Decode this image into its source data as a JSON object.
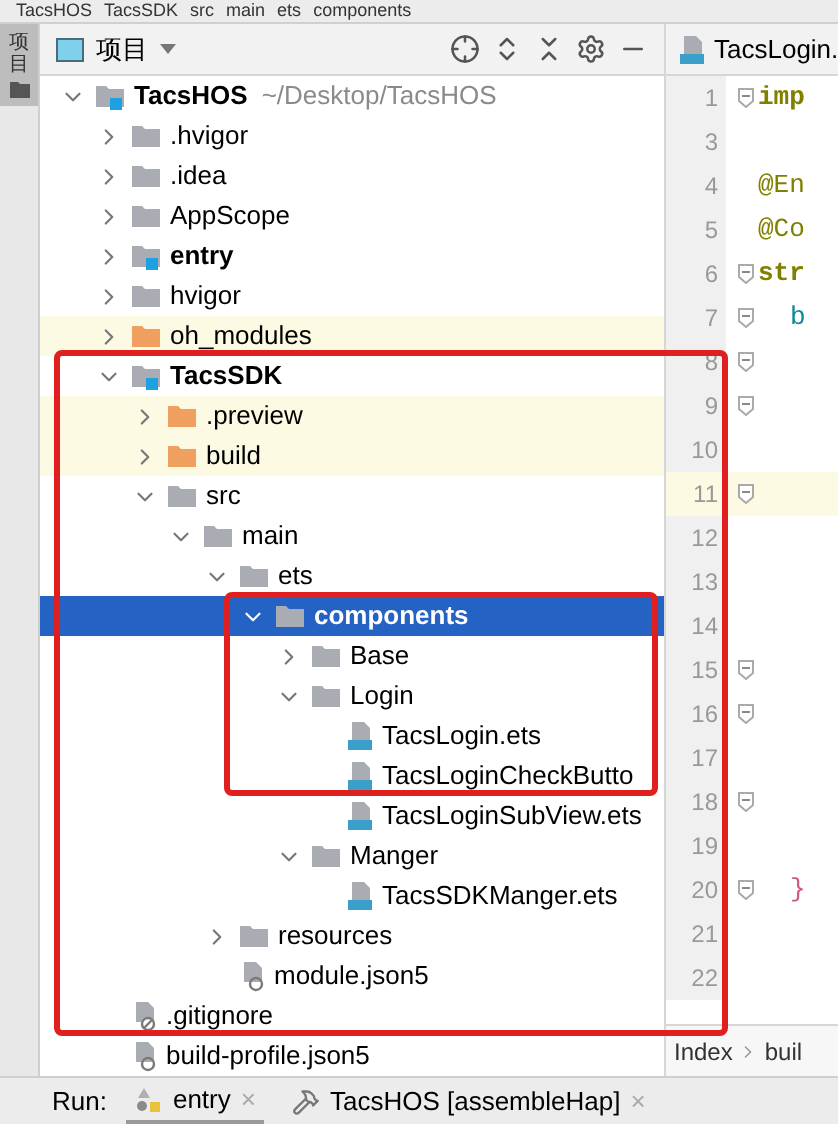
{
  "breadcrumbs": [
    "TacsHOS",
    "TacsSDK",
    "src",
    "main",
    "ets",
    "components"
  ],
  "side_tab": {
    "label": "项目",
    "selected": true
  },
  "project_panel": {
    "title": "项目"
  },
  "tree": [
    {
      "label": "TacsHOS",
      "kind": "module",
      "path": "~/Desktop/TacsHOS",
      "expanded": true,
      "selected": false,
      "children": [
        {
          "label": ".hvigor",
          "kind": "folder",
          "expanded": false,
          "selected": false
        },
        {
          "label": ".idea",
          "kind": "folder",
          "expanded": false,
          "selected": false
        },
        {
          "label": "AppScope",
          "kind": "folder",
          "expanded": false,
          "selected": false
        },
        {
          "label": "entry",
          "kind": "module",
          "expanded": false,
          "selected": false
        },
        {
          "label": "hvigor",
          "kind": "folder",
          "expanded": false,
          "selected": false
        },
        {
          "label": "oh_modules",
          "kind": "excluded",
          "expanded": false,
          "selected": false
        },
        {
          "label": "TacsSDK",
          "kind": "module",
          "expanded": true,
          "selected": false,
          "children": [
            {
              "label": ".preview",
              "kind": "excluded",
              "expanded": false,
              "selected": false
            },
            {
              "label": "build",
              "kind": "excluded",
              "expanded": false,
              "selected": false
            },
            {
              "label": "src",
              "kind": "folder",
              "expanded": true,
              "selected": false,
              "children": [
                {
                  "label": "main",
                  "kind": "folder",
                  "expanded": true,
                  "selected": false,
                  "children": [
                    {
                      "label": "ets",
                      "kind": "folder",
                      "expanded": true,
                      "selected": false,
                      "children": [
                        {
                          "label": "components",
                          "kind": "folder",
                          "expanded": true,
                          "selected": true,
                          "children": [
                            {
                              "label": "Base",
                              "kind": "folder",
                              "expanded": false,
                              "selected": false
                            },
                            {
                              "label": "Login",
                              "kind": "folder",
                              "expanded": true,
                              "selected": false,
                              "children": [
                                {
                                  "label": "TacsLogin.ets",
                                  "kind": "ets",
                                  "selected": false
                                },
                                {
                                  "label": "TacsLoginCheckButto",
                                  "kind": "ets",
                                  "selected": false
                                },
                                {
                                  "label": "TacsLoginSubView.ets",
                                  "kind": "ets",
                                  "selected": false
                                }
                              ]
                            },
                            {
                              "label": "Manger",
                              "kind": "folder",
                              "expanded": true,
                              "selected": false,
                              "children": [
                                {
                                  "label": "TacsSDKManger.ets",
                                  "kind": "ets",
                                  "selected": false
                                }
                              ]
                            }
                          ]
                        }
                      ]
                    },
                    {
                      "label": "resources",
                      "kind": "folder",
                      "expanded": false,
                      "selected": false
                    },
                    {
                      "label": "module.json5",
                      "kind": "json",
                      "selected": false
                    }
                  ]
                }
              ]
            }
          ]
        },
        {
          "label": ".gitignore",
          "kind": "ignore",
          "selected": false
        },
        {
          "label": "build-profile.json5",
          "kind": "json",
          "selected": false
        }
      ]
    }
  ],
  "editor": {
    "tab": "TacsLogin.",
    "lines": [
      {
        "number": "1",
        "code": "imp",
        "kind": "keyword",
        "fold": true,
        "current": false
      },
      {
        "number": "3",
        "fold": false,
        "current": false
      },
      {
        "number": "4",
        "code": "@En",
        "kind": "annotation",
        "fold": false,
        "current": false
      },
      {
        "number": "5",
        "code": "@Co",
        "kind": "annotation",
        "fold": false,
        "current": false
      },
      {
        "number": "6",
        "code": "str",
        "kind": "keyword",
        "fold": true,
        "current": false
      },
      {
        "number": "7",
        "code": "b",
        "kind": "identifier",
        "fold": true,
        "current": false
      },
      {
        "number": "8",
        "fold": true,
        "current": false
      },
      {
        "number": "9",
        "fold": true,
        "current": false
      },
      {
        "number": "10",
        "fold": false,
        "current": false
      },
      {
        "number": "11",
        "fold": true,
        "current": true
      },
      {
        "number": "12",
        "fold": false,
        "current": false
      },
      {
        "number": "13",
        "fold": false,
        "current": false
      },
      {
        "number": "14",
        "fold": false,
        "current": false
      },
      {
        "number": "15",
        "fold": true,
        "current": false
      },
      {
        "number": "16",
        "fold": true,
        "current": false
      },
      {
        "number": "17",
        "fold": false,
        "current": false
      },
      {
        "number": "18",
        "fold": true,
        "current": false
      },
      {
        "number": "19",
        "fold": false,
        "current": false
      },
      {
        "number": "20",
        "code": "}",
        "kind": "brace",
        "fold": true,
        "current": false
      },
      {
        "number": "21",
        "fold": false,
        "current": false
      },
      {
        "number": "22",
        "fold": false,
        "current": false
      }
    ],
    "breadcrumb": [
      "Index",
      "buil"
    ]
  },
  "run_bar": {
    "label": "Run:",
    "tabs": [
      {
        "label": "entry",
        "kind": "app",
        "selected": true,
        "close": "×"
      },
      {
        "label": "TacsHOS [assembleHap]",
        "kind": "build",
        "selected": false,
        "close": "×"
      }
    ]
  }
}
